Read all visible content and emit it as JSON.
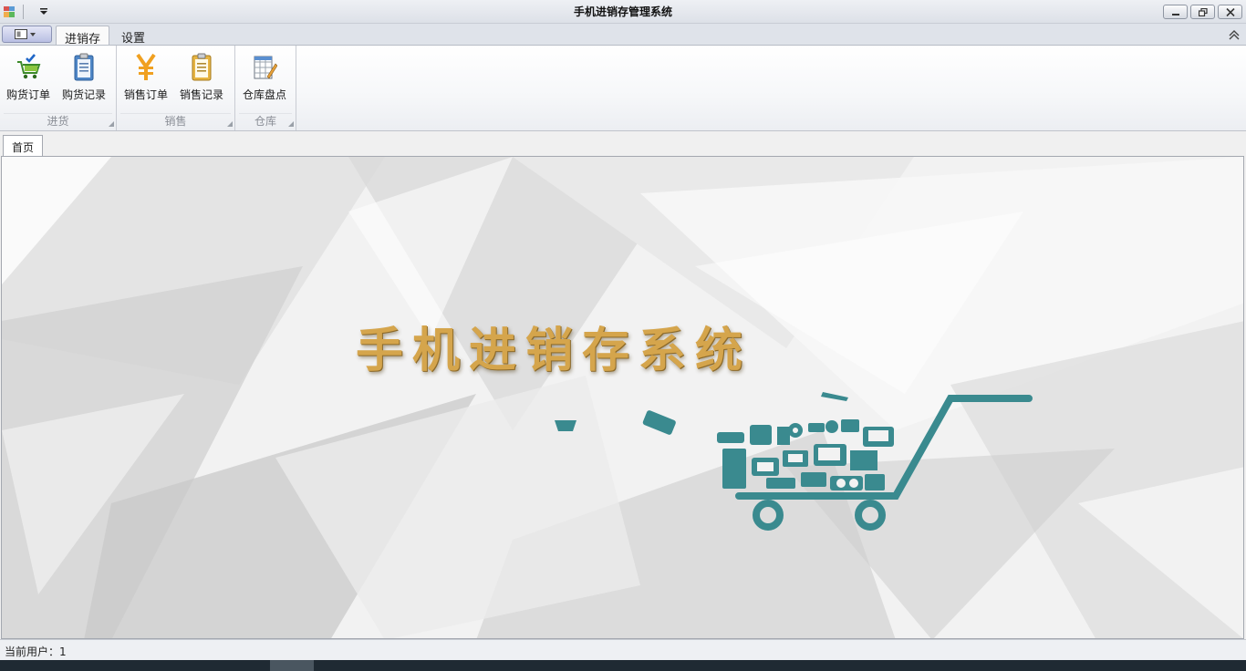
{
  "window": {
    "title": "手机进销存管理系统",
    "quick_access": [
      "app-icon",
      "customize-dropdown"
    ]
  },
  "ribbon_tabs": [
    {
      "label": "进销存",
      "active": true
    },
    {
      "label": "设置",
      "active": false
    }
  ],
  "ribbon_groups": [
    {
      "label": "进货",
      "buttons": [
        {
          "label": "购货订单",
          "icon": "cart-check-icon"
        },
        {
          "label": "购货记录",
          "icon": "clipboard-icon"
        }
      ]
    },
    {
      "label": "销售",
      "buttons": [
        {
          "label": "销售订单",
          "icon": "yuan-icon"
        },
        {
          "label": "销售记录",
          "icon": "clipboard-icon"
        }
      ]
    },
    {
      "label": "仓库",
      "buttons": [
        {
          "label": "仓库盘点",
          "icon": "inventory-sheet-icon"
        }
      ]
    }
  ],
  "document_tabs": [
    {
      "label": "首页",
      "active": true
    }
  ],
  "banner": {
    "title": "手机进销存系统",
    "title_color": "#d5a54c",
    "cart_color": "#3a8a8f"
  },
  "status": {
    "text": "当前用户：1"
  }
}
